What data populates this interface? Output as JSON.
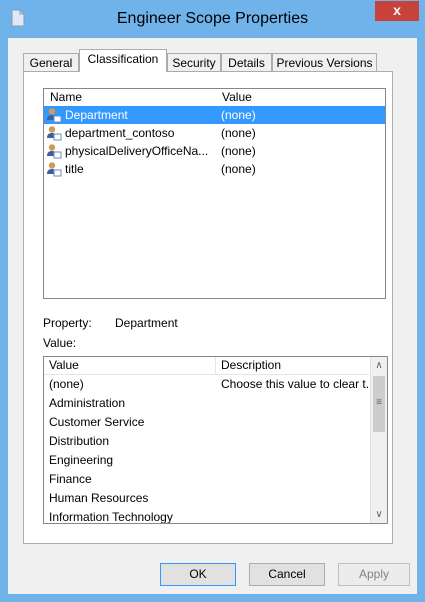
{
  "window": {
    "title": "Engineer Scope Properties",
    "close_glyph": "x"
  },
  "tabs": [
    {
      "label": "General"
    },
    {
      "label": "Classification"
    },
    {
      "label": "Security"
    },
    {
      "label": "Details"
    },
    {
      "label": "Previous Versions"
    }
  ],
  "properties_list": {
    "columns": [
      "Name",
      "Value"
    ],
    "rows": [
      {
        "name": "Department",
        "value": "(none)"
      },
      {
        "name": "department_contoso",
        "value": "(none)"
      },
      {
        "name": "physicalDeliveryOfficeNa...",
        "value": "(none)"
      },
      {
        "name": "title",
        "value": "(none)"
      }
    ]
  },
  "details": {
    "property_label": "Property:",
    "property_value": "Department",
    "value_label": "Value:"
  },
  "values_list": {
    "columns": [
      "Value",
      "Description"
    ],
    "rows": [
      {
        "value": "(none)",
        "description": "Choose this value to clear t..."
      },
      {
        "value": "Administration",
        "description": ""
      },
      {
        "value": "Customer Service",
        "description": ""
      },
      {
        "value": "Distribution",
        "description": ""
      },
      {
        "value": "Engineering",
        "description": ""
      },
      {
        "value": "Finance",
        "description": ""
      },
      {
        "value": "Human Resources",
        "description": ""
      },
      {
        "value": "Information Technology",
        "description": ""
      }
    ]
  },
  "buttons": {
    "ok": "OK",
    "cancel": "Cancel",
    "apply": "Apply"
  },
  "colors": {
    "title_bar": "#70b3ea",
    "selection": "#3399ff",
    "close": "#c7423a"
  }
}
